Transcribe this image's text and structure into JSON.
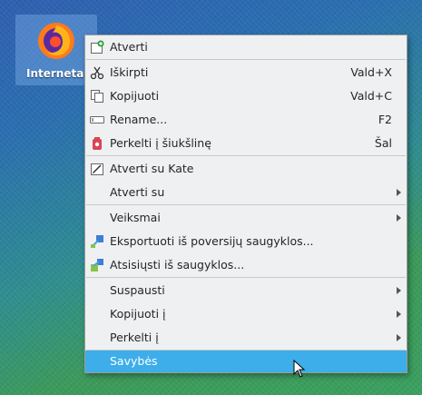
{
  "desktop": {
    "icon_label": "Internetas",
    "icon_name": "firefox-icon"
  },
  "menu": {
    "open": "Atverti",
    "cut": "Iškirpti",
    "cut_shortcut": "Vald+X",
    "copy": "Kopijuoti",
    "copy_shortcut": "Vald+C",
    "rename": "Rename...",
    "rename_shortcut": "F2",
    "trash": "Perkelti į šiukšlinę",
    "trash_shortcut": "Šal",
    "open_kate": "Atverti su Kate",
    "open_with": "Atverti su",
    "actions": "Veiksmai",
    "export": "Eksportuoti iš poversijų saugyklos...",
    "download": "Atsisiųsti iš saugyklos...",
    "compress": "Suspausti",
    "copy_to": "Kopijuoti į",
    "move_to": "Perkelti į",
    "properties": "Savybės"
  },
  "colors": {
    "highlight": "#3daee9",
    "menu_bg": "#eff0f1"
  }
}
